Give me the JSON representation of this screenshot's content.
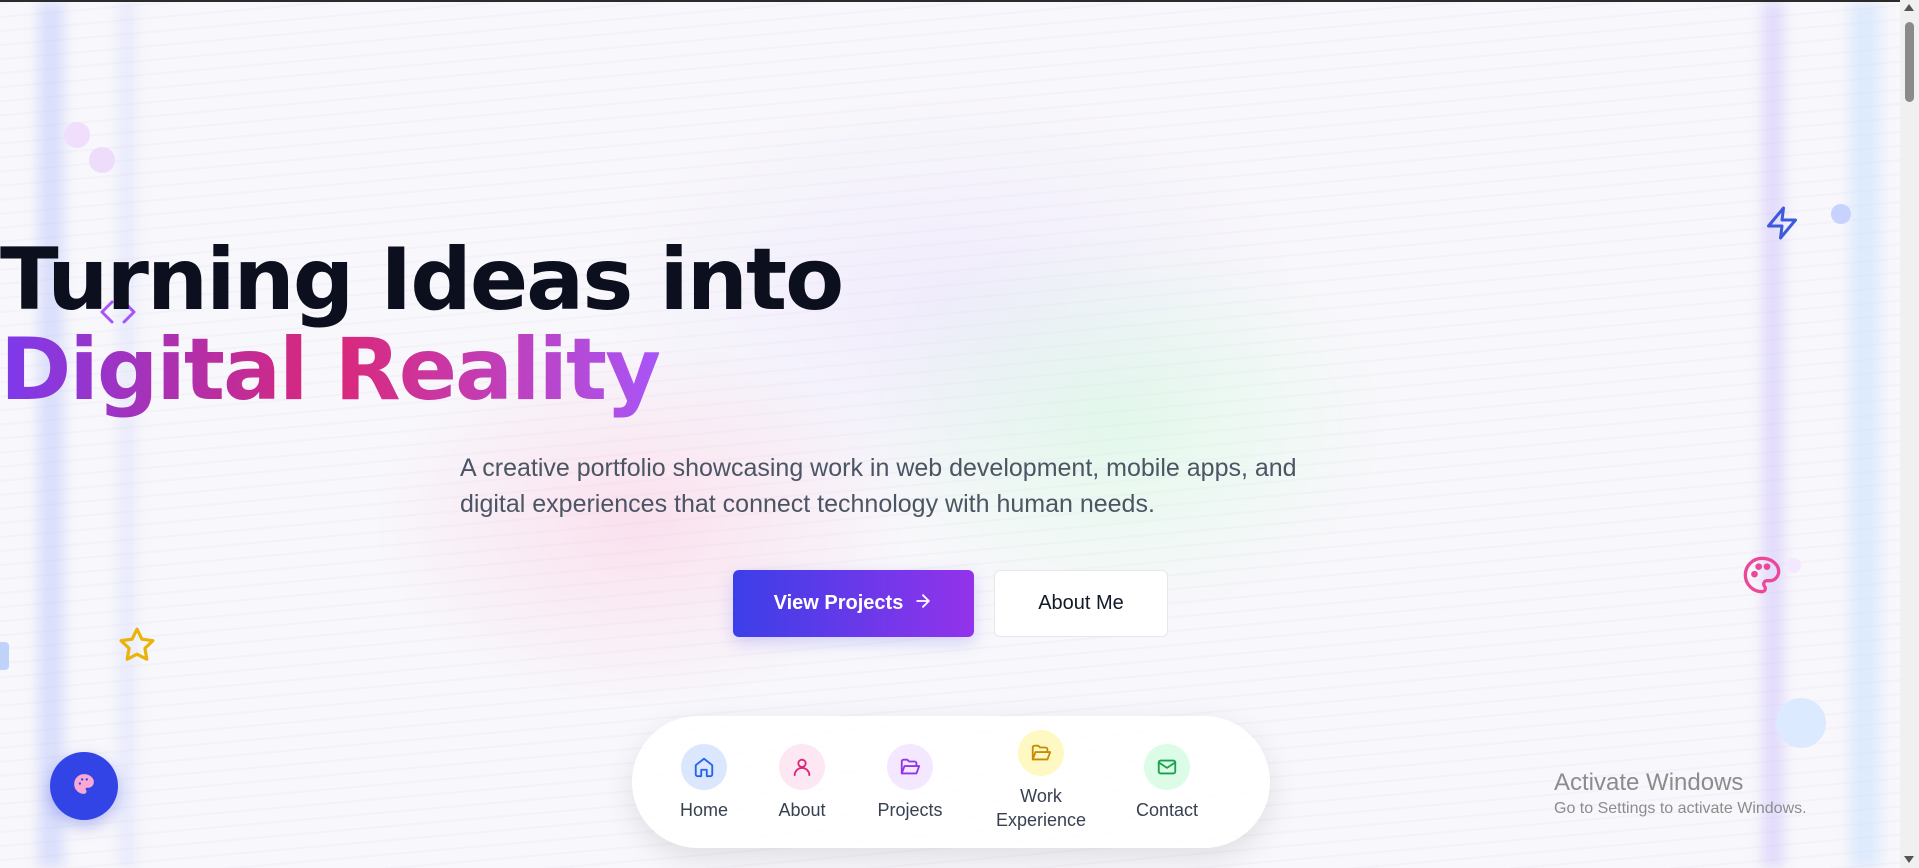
{
  "hero": {
    "title_line1": "Turning Ideas into",
    "title_line2": "Digital Reality",
    "subtitle_line1": "A creative portfolio showcasing work in web development, mobile apps, and",
    "subtitle_line2": "digital experiences that connect technology with human needs.",
    "primary_button_label": "View Projects",
    "secondary_button_label": "About Me"
  },
  "nav_dock": {
    "items": [
      {
        "label": "Home",
        "icon": "home-icon",
        "bg": "#dbe7fe",
        "color": "#2563eb"
      },
      {
        "label": "About",
        "icon": "user-icon",
        "bg": "#fce7f3",
        "color": "#db2777"
      },
      {
        "label": "Projects",
        "icon": "folder-open-icon",
        "bg": "#f3e8ff",
        "color": "#9333ea"
      },
      {
        "label": "Work Experience",
        "label_line1": "Work",
        "label_line2": "Experience",
        "icon": "folder-open-icon",
        "bg": "#fef9c3",
        "color": "#ca8a04"
      },
      {
        "label": "Contact",
        "icon": "mail-icon",
        "bg": "#dcfce7",
        "color": "#16a34a"
      }
    ]
  },
  "fab": {
    "icon": "palette-icon"
  },
  "decorations": [
    "code-icon",
    "zap-icon",
    "palette-icon",
    "star-icon"
  ],
  "watermark": {
    "title": "Activate Windows",
    "subtitle": "Go to Settings to activate Windows."
  },
  "colors": {
    "accent_blue": "#3b3fe8",
    "accent_purple": "#9333ea",
    "accent_pink": "#db2777"
  }
}
